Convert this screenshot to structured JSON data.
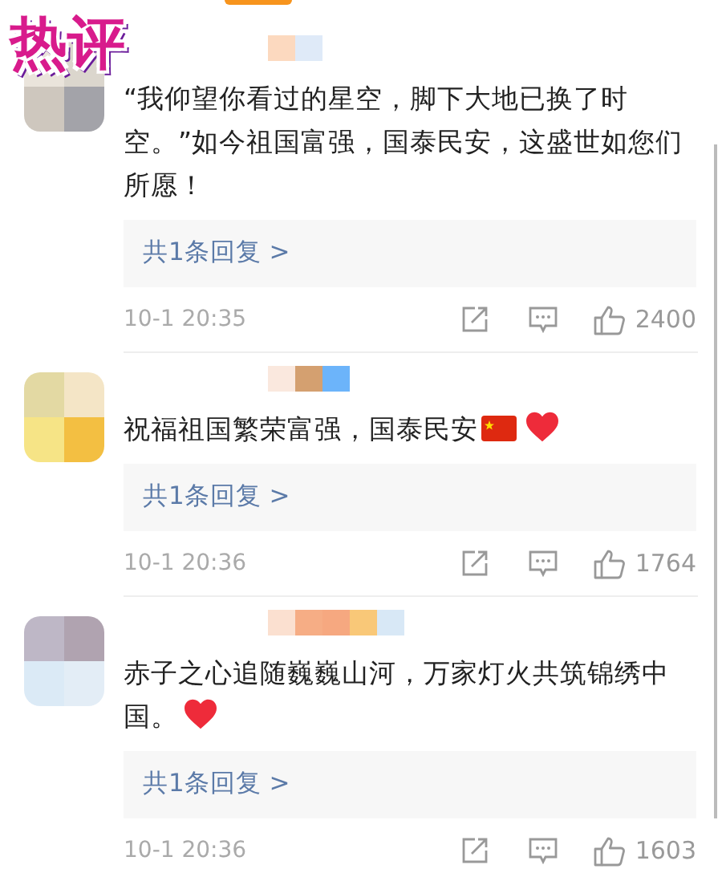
{
  "badge": "热评",
  "comments": [
    {
      "text": "“我仰望你看过的星空，脚下大地已换了时空。”如今祖国富强，国泰民安，这盛世如您们所愿！",
      "replies": "共1条回复 >",
      "time": "10-1 20:35",
      "likes": "2400"
    },
    {
      "text": "祝福祖国繁荣富强，国泰民安",
      "emojis": [
        {
          "kind": "flag"
        },
        {
          "kind": "heart"
        }
      ],
      "replies": "共1条回复 >",
      "time": "10-1 20:36",
      "likes": "1764"
    },
    {
      "text": "赤子之心追随巍巍山河，万家灯火共筑锦绣中国。",
      "emojis": [
        {
          "kind": "heart"
        }
      ],
      "replies": "共1条回复 >",
      "time": "10-1 20:36",
      "likes": "1603"
    }
  ]
}
